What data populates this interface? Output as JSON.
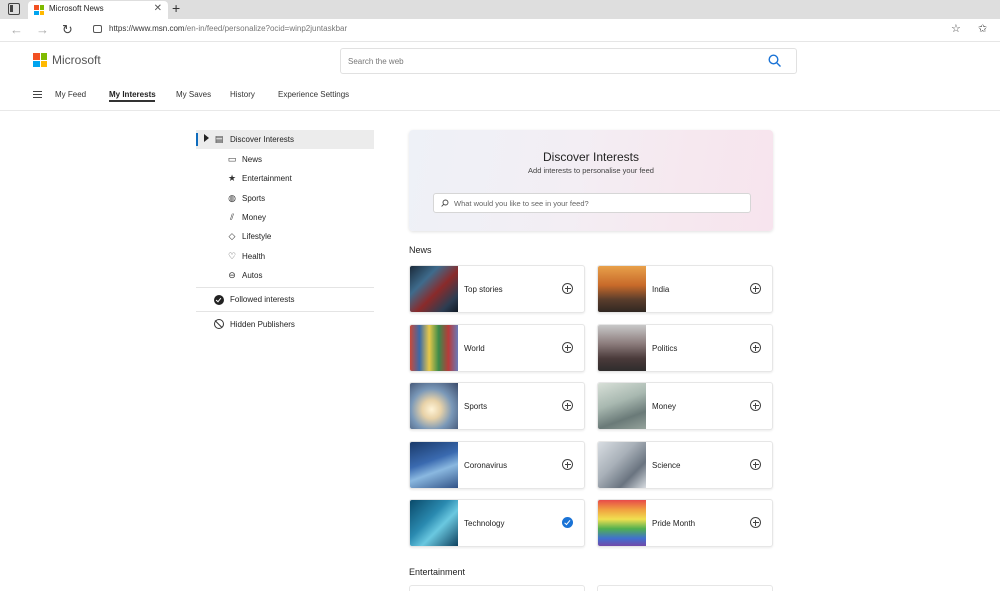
{
  "browser": {
    "tab_title": "Microsoft News",
    "tab_close": "✕",
    "new_tab": "+",
    "url_host": "https://www.msn.com",
    "url_path": "/en-in/feed/personalize?ocid=winp2juntaskbar"
  },
  "header": {
    "brand": "Microsoft",
    "search_placeholder": "Search the web",
    "nav": [
      {
        "label": "My Feed",
        "active": false
      },
      {
        "label": "My Interests",
        "active": true
      },
      {
        "label": "My Saves",
        "active": false
      },
      {
        "label": "History",
        "active": false
      },
      {
        "label": "Experience Settings",
        "active": false
      }
    ]
  },
  "sidebar": {
    "discover": {
      "label": "Discover Interests",
      "icon": "discover-icon"
    },
    "categories": [
      {
        "label": "News",
        "icon": "news-icon",
        "glyph": "▭"
      },
      {
        "label": "Entertainment",
        "icon": "star-icon",
        "glyph": "★"
      },
      {
        "label": "Sports",
        "icon": "ball-icon",
        "glyph": "◍"
      },
      {
        "label": "Money",
        "icon": "chart-icon",
        "glyph": "⫽"
      },
      {
        "label": "Lifestyle",
        "icon": "diamond-icon",
        "glyph": "◇"
      },
      {
        "label": "Health",
        "icon": "heart-icon",
        "glyph": "♡"
      },
      {
        "label": "Autos",
        "icon": "car-icon",
        "glyph": "⊖"
      }
    ],
    "followed": "Followed interests",
    "hidden": "Hidden Publishers"
  },
  "discover_card": {
    "title": "Discover Interests",
    "subtitle": "Add interests to personalise your feed",
    "placeholder": "What would you like to see in your feed?"
  },
  "sections": {
    "news_title": "News",
    "entertainment_title": "Entertainment"
  },
  "news_cards": [
    {
      "label": "Top stories",
      "followed": false,
      "thumb": "linear-gradient(135deg,#1b2a3a 0%,#3e6b8c 30%,#8a2a2a 55%,#2c3d52 80%,#0e1620 100%)"
    },
    {
      "label": "India",
      "followed": false,
      "thumb": "linear-gradient(180deg,#e8a04a 0%,#c86a2a 40%,#5a3d2c 70%,#2a2420 100%)"
    },
    {
      "label": "World",
      "followed": false,
      "thumb": "linear-gradient(90deg,#c84a3a 0%,#3a6aa8 20%,#e8c84a 40%,#3a8a4a 60%,#b83a3a 80%,#6a7ab8 100%)"
    },
    {
      "label": "Politics",
      "followed": false,
      "thumb": "linear-gradient(180deg,#c8c8c8 0%,#8a7a7a 40%,#4a3a3a 70%,#2a2a2a 100%)"
    },
    {
      "label": "Sports",
      "followed": false,
      "thumb": "radial-gradient(circle at 45% 55%,#fff4d8 0%,#e8d2a8 25%,#7a98b8 55%,#3a4a6a 100%)"
    },
    {
      "label": "Money",
      "followed": false,
      "thumb": "linear-gradient(160deg,#d8e0d8 0%,#a8b8b0 40%,#6a7a78 70%,#9aa8a0 100%)"
    },
    {
      "label": "Coronavirus",
      "followed": false,
      "thumb": "linear-gradient(160deg,#1a3a6a 0%,#3a6ab0 40%,#8ab8e0 60%,#2a4a80 100%)"
    },
    {
      "label": "Science",
      "followed": false,
      "thumb": "linear-gradient(135deg,#d8dde2 0%,#a8b0b8 40%,#6a7480 70%,#e0e4e8 100%)"
    },
    {
      "label": "Technology",
      "followed": true,
      "thumb": "linear-gradient(135deg,#0a4a6a 0%,#2a8ab0 40%,#6ac8e0 60%,#0a3a58 100%)"
    },
    {
      "label": "Pride Month",
      "followed": false,
      "thumb": "linear-gradient(180deg,#e84a4a 0%,#f0a040 20%,#f0e050 40%,#50b050 60%,#4070d0 80%,#8040a0 100%)"
    }
  ],
  "colors": {
    "accent": "#0f6cbd",
    "check": "#1a73d6"
  }
}
